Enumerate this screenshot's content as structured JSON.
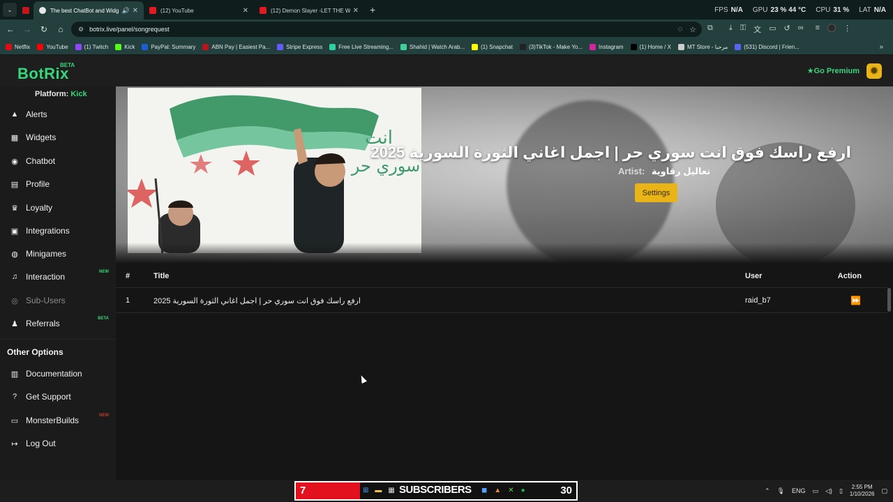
{
  "browser": {
    "tabs": [
      {
        "label": "",
        "favicon_color": "#c4161c"
      },
      {
        "label": "The best ChatBot and Widg",
        "favicon_color": "#37d67a",
        "active": true
      },
      {
        "label": "(12) YouTube",
        "favicon_color": "#e21b23"
      },
      {
        "label": "(12) Demon Slayer -LET THE W",
        "favicon_color": "#e21b23"
      }
    ],
    "hud": {
      "fps_label": "FPS",
      "fps_value": "N/A",
      "gpu_label": "GPU",
      "gpu_value": "23 % 44 °C",
      "cpu_label": "CPU",
      "cpu_value": "31 %",
      "lat_label": "LAT",
      "lat_value": "N/A"
    },
    "url": "botrix.live/panel/songrequest",
    "bookmarks": [
      {
        "label": "Netflix",
        "color": "#e50914"
      },
      {
        "label": "YouTube",
        "color": "#ff0000"
      },
      {
        "label": "(1) Twitch",
        "color": "#9146ff"
      },
      {
        "label": "Kick",
        "color": "#53fc18"
      },
      {
        "label": "PayPal: Summary",
        "color": "#1a5fd1"
      },
      {
        "label": "ABN Pay | Easiest Pa...",
        "color": "#b8141c"
      },
      {
        "label": "Stripe Express",
        "color": "#635bff"
      },
      {
        "label": "Free Live Streaming...",
        "color": "#2bd3a0"
      },
      {
        "label": "Shahid | Watch Arab...",
        "color": "#3fcf9c"
      },
      {
        "label": "(1) Snapchat",
        "color": "#fffc00"
      },
      {
        "label": "(3)TikTok - Make Yo...",
        "color": "#222222"
      },
      {
        "label": "Instagram",
        "color": "#d6249f"
      },
      {
        "label": "(1) Home / X",
        "color": "#000000"
      },
      {
        "label": "MT Store - مرحبا",
        "color": "#cccccc"
      },
      {
        "label": "(531) Discord | Frien...",
        "color": "#5865f2"
      }
    ]
  },
  "app": {
    "logo": "BotRix",
    "logo_badge": "BETA",
    "premium_label": "Go Premium",
    "platform_label": "Platform:",
    "platform_value": "Kick"
  },
  "sidebar": {
    "items": [
      {
        "label": "Alerts",
        "icon": "warning-icon",
        "glyph": "▲"
      },
      {
        "label": "Widgets",
        "icon": "grid-icon",
        "glyph": "▦"
      },
      {
        "label": "Chatbot",
        "icon": "robot-icon",
        "glyph": "◉"
      },
      {
        "label": "Profile",
        "icon": "id-card-icon",
        "glyph": "▤"
      },
      {
        "label": "Loyalty",
        "icon": "trophy-icon",
        "glyph": "♛"
      },
      {
        "label": "Integrations",
        "icon": "plug-icon",
        "glyph": "▣"
      },
      {
        "label": "Minigames",
        "icon": "gamepad-icon",
        "glyph": "◍"
      },
      {
        "label": "Interaction",
        "icon": "music-icon",
        "glyph": "♫",
        "badge": "NEW",
        "badge_color": "#37d67a"
      },
      {
        "label": "Sub-Users",
        "icon": "users-icon",
        "glyph": "◎",
        "dim": true
      },
      {
        "label": "Referrals",
        "icon": "user-group-icon",
        "glyph": "♟",
        "badge": "BETA",
        "badge_color": "#37d67a"
      }
    ],
    "other_title": "Other Options",
    "other_items": [
      {
        "label": "Documentation",
        "icon": "book-icon",
        "glyph": "▥"
      },
      {
        "label": "Get Support",
        "icon": "question-icon",
        "glyph": "?"
      },
      {
        "label": "MonsterBuilds",
        "icon": "laptop-icon",
        "glyph": "▭",
        "badge": "NEW",
        "badge_color": "#c0392b"
      },
      {
        "label": "Log Out",
        "icon": "logout-icon",
        "glyph": "↦"
      }
    ]
  },
  "hero": {
    "title": "ارفع راسك فوق انت سوري حر | اجمل اغاني الثورة السورية 2025",
    "artist_label": "Artist:",
    "artist_value": "تعاليل رقاوية",
    "settings_label": "Settings",
    "cover_calligraphy_1": "انت",
    "cover_calligraphy_2": "سوري حر"
  },
  "table": {
    "headers": {
      "num": "#",
      "title": "Title",
      "user": "User",
      "action": "Action"
    },
    "rows": [
      {
        "num": "1",
        "title": "ارفع راسك فوق انت سوري حر | اجمل اغاني الثورة السورية 2025",
        "user": "raid_b7"
      }
    ]
  },
  "taskbar": {
    "left_count": "7",
    "subscribers_label": "SUBSCRIBERS",
    "right_count": "30",
    "lang": "ENG",
    "time": "2:55 PM",
    "date": "1/10/2026"
  }
}
